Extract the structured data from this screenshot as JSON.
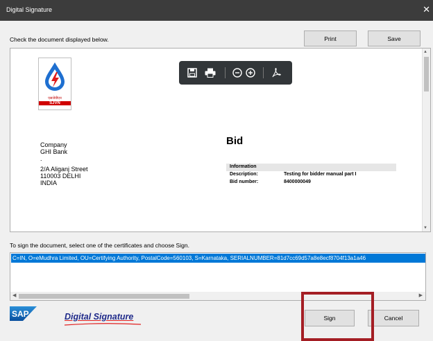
{
  "window": {
    "title": "Digital Signature",
    "close_glyph": "✕"
  },
  "header": {
    "instruction": "Check the document displayed below."
  },
  "buttons": {
    "print": "Print",
    "save": "Save",
    "sign": "Sign",
    "cancel": "Cancel"
  },
  "document": {
    "logo_hindi": "एसजेवीएन",
    "logo_name": "SJVN",
    "company_lines": [
      "Company",
      "GHI Bank"
    ],
    "dot": ".",
    "address_lines": [
      "2/A Aliganj Street",
      "110003 DELHI",
      "INDIA"
    ],
    "bid_title": "Bid",
    "info_title": "Information",
    "info_rows": [
      {
        "key": "Description:",
        "value": "Testing for bidder manual part I"
      },
      {
        "key": "Bid number:",
        "value": "8400000049"
      }
    ]
  },
  "pdf_toolbar": {
    "icons": [
      "save-icon",
      "print-icon",
      "zoom-out-icon",
      "zoom-in-icon",
      "acrobat-icon"
    ]
  },
  "sign_section": {
    "instruction": "To sign the document, select one of the certificates and choose Sign.",
    "certificates": [
      "C=IN, O=eMudhra Limited, OU=Certifying Authority, PostalCode=560103, S=Karnataka, SERIALNUMBER=81d7cc69d57a8e8ecf8704f13a1a46"
    ]
  },
  "footer": {
    "sap_text": "SAP",
    "brand_text": "Digital Signature"
  },
  "colors": {
    "selection": "#0078d7",
    "highlight_box": "#a41e24",
    "titlebar": "#3c3c3c"
  }
}
